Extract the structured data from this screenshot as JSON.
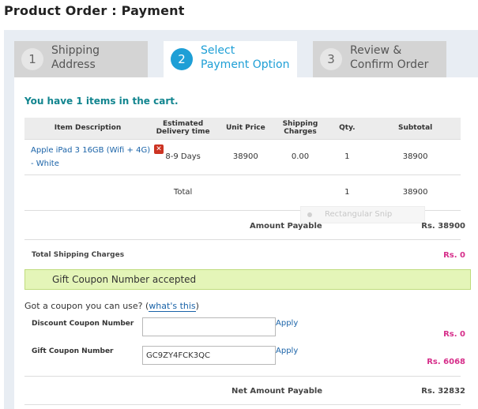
{
  "page_title": "Product Order : Payment",
  "steps": [
    {
      "num": "1",
      "label_line1": "Shipping",
      "label_line2": "Address",
      "active": false
    },
    {
      "num": "2",
      "label_line1": "Select",
      "label_line2": "Payment Option",
      "active": true
    },
    {
      "num": "3",
      "label_line1": "Review &",
      "label_line2": "Confirm Order",
      "active": false
    }
  ],
  "cart": {
    "summary": "You have 1 items in the cart.",
    "headers": [
      "Item Description",
      "Estimated Delivery time",
      "Unit Price",
      "Shipping Charges",
      "Qty.",
      "Subtotal"
    ],
    "items": [
      {
        "description": "Apple iPad 3 16GB (Wifi + 4G) - White",
        "delivery": "8-9 Days",
        "unit_price": "38900",
        "shipping": "0.00",
        "qty": "1",
        "subtotal": "38900"
      }
    ],
    "total_row": {
      "label": "Total",
      "qty": "1",
      "subtotal": "38900"
    }
  },
  "amounts": {
    "amount_payable_label": "Amount Payable",
    "amount_payable_value": "Rs. 38900",
    "shipping_label": "Total Shipping Charges",
    "shipping_value": "Rs. 0"
  },
  "coupon": {
    "accepted_message": "Gift Coupon Number accepted",
    "question_text": "Got a coupon you can use? (",
    "whats_this": "what's this",
    "question_close": ")",
    "discount_label": "Discount Coupon Number",
    "discount_value": "",
    "discount_apply": "Apply",
    "discount_amount": "Rs. 0",
    "gift_label": "Gift Coupon Number",
    "gift_value": "GC9ZY4FCK3QC",
    "gift_apply": "Apply",
    "gift_amount": "Rs. 6068"
  },
  "net": {
    "label": "Net Amount Payable",
    "value": "Rs. 32832"
  },
  "overlay": {
    "snip_label": "Rectangular Snip"
  },
  "colors": {
    "accent": "#1e9fd6",
    "cart_text": "#12858f",
    "link": "#1a63a8",
    "highlight_amount": "#d62e8a",
    "success_bg": "#e4f5b8"
  }
}
